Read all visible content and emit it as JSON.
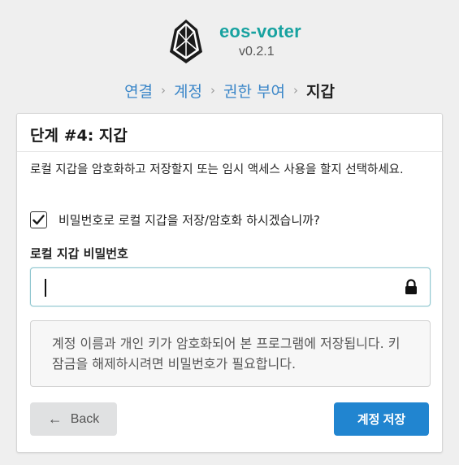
{
  "app": {
    "name": "eos-voter",
    "version": "v0.2.1",
    "logo_icon": "eos-logo-icon"
  },
  "breadcrumb": {
    "items": [
      {
        "label": "연결",
        "active": false
      },
      {
        "label": "계정",
        "active": false
      },
      {
        "label": "권한 부여",
        "active": false
      },
      {
        "label": "지갑",
        "active": true
      }
    ],
    "separator": "›"
  },
  "step": {
    "title": "단계 #4: 지갑",
    "description": "로컬 지갑을 암호화하고 저장할지 또는 임시 액세스 사용을 할지 선택하세요."
  },
  "encrypt_option": {
    "label": "비밀번호로 로컬 지갑을 저장/암호화 하시겠습니까?",
    "checked": true,
    "icon": "checkmark-icon"
  },
  "password_field": {
    "label": "로컬 지갑 비밀번호",
    "value": "",
    "placeholder": "",
    "icon": "lock-icon"
  },
  "info": {
    "text": "계정 이름과 개인 키가 암호화되어 본 프로그램에 저장됩니다. 키 잠금을 해제하시려면 비밀번호가 필요합니다."
  },
  "buttons": {
    "back_label": "Back",
    "back_icon": "arrow-left-icon",
    "save_label": "계정 저장"
  },
  "colors": {
    "brand": "#17a2a0",
    "primary": "#2185d0",
    "link": "#3a86c8",
    "background": "#efefef"
  }
}
